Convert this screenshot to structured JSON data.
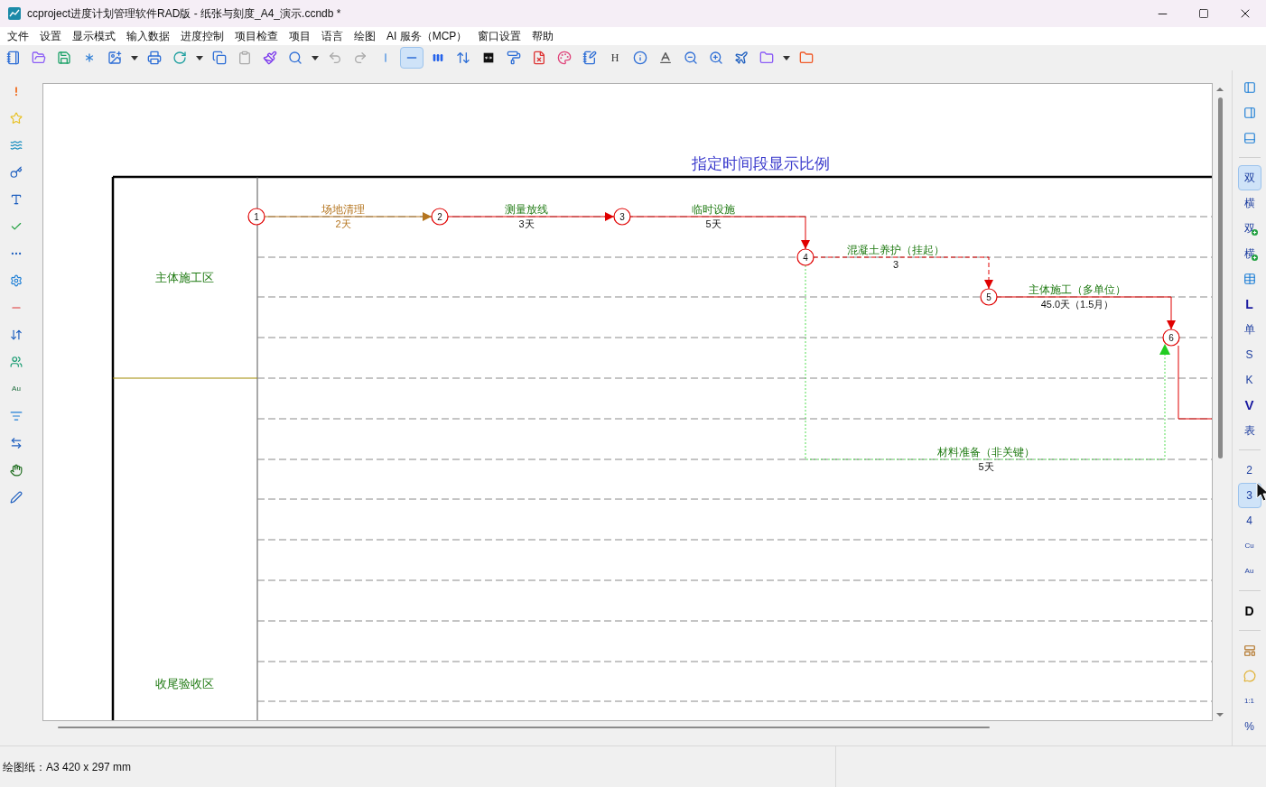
{
  "window": {
    "title": "ccproject进度计划管理软件RAD版 - 纸张与刻度_A4_演示.ccndb *"
  },
  "menu": [
    "文件",
    "设置",
    "显示模式",
    "输入数据",
    "进度控制",
    "项目检查",
    "项目",
    "语言",
    "绘图",
    "AI 服务（MCP）",
    "窗口设置",
    "帮助"
  ],
  "toolbar": [
    {
      "kind": "icon",
      "selected": false
    },
    {
      "kind": "icon",
      "selected": false
    },
    {
      "kind": "icon",
      "selected": false
    },
    {
      "kind": "icon",
      "selected": false
    },
    {
      "kind": "icon",
      "selected": false
    },
    {
      "kind": "caret",
      "selected": false
    },
    {
      "kind": "icon",
      "selected": false
    },
    {
      "kind": "icon",
      "selected": false
    },
    {
      "kind": "caret",
      "selected": false
    },
    {
      "kind": "icon",
      "selected": false
    },
    {
      "kind": "icon",
      "selected": false
    },
    {
      "kind": "icon",
      "selected": false
    },
    {
      "kind": "icon",
      "selected": false
    },
    {
      "kind": "caret",
      "selected": false
    },
    {
      "kind": "icon",
      "selected": false
    },
    {
      "kind": "icon",
      "selected": false
    },
    {
      "kind": "icon",
      "selected": false
    },
    {
      "kind": "icon",
      "selected": true
    },
    {
      "kind": "icon",
      "selected": false
    },
    {
      "kind": "icon",
      "selected": false
    },
    {
      "kind": "icon",
      "selected": false
    },
    {
      "kind": "icon",
      "selected": false
    },
    {
      "kind": "icon",
      "selected": false
    },
    {
      "kind": "icon",
      "selected": false
    },
    {
      "kind": "icon",
      "selected": false
    },
    {
      "kind": "glyph",
      "label": "H",
      "selected": false
    },
    {
      "kind": "icon",
      "selected": false
    },
    {
      "kind": "icon",
      "selected": false
    },
    {
      "kind": "icon",
      "selected": false
    },
    {
      "kind": "icon",
      "selected": false
    },
    {
      "kind": "icon",
      "selected": false
    },
    {
      "kind": "icon",
      "selected": false
    },
    {
      "kind": "caret",
      "selected": false
    },
    {
      "kind": "icon",
      "selected": false
    }
  ],
  "left_toolbar": [
    {
      "kind": "icon"
    },
    {
      "kind": "icon"
    },
    {
      "kind": "icon"
    },
    {
      "kind": "icon"
    },
    {
      "kind": "icon"
    },
    {
      "kind": "icon"
    },
    {
      "kind": "icon"
    },
    {
      "kind": "icon"
    },
    {
      "kind": "icon"
    },
    {
      "kind": "icon"
    },
    {
      "kind": "icon"
    },
    {
      "kind": "text",
      "label": "Au"
    },
    {
      "kind": "icon"
    },
    {
      "kind": "icon"
    },
    {
      "kind": "icon"
    },
    {
      "kind": "icon"
    }
  ],
  "right_toolbar": [
    {
      "kind": "icon",
      "selected": false
    },
    {
      "kind": "icon",
      "selected": false
    },
    {
      "kind": "icon",
      "selected": false
    },
    {
      "kind": "separator"
    },
    {
      "kind": "text",
      "label": "双",
      "selected": true
    },
    {
      "kind": "text",
      "label": "横",
      "selected": false
    },
    {
      "kind": "text-plus",
      "label": "双",
      "selected": false
    },
    {
      "kind": "text-plus",
      "label": "横",
      "selected": false
    },
    {
      "kind": "icon",
      "selected": false
    },
    {
      "kind": "text",
      "label": "L",
      "selected": false
    },
    {
      "kind": "text",
      "label": "单",
      "selected": false
    },
    {
      "kind": "text",
      "label": "S",
      "selected": false
    },
    {
      "kind": "text",
      "label": "K",
      "selected": false
    },
    {
      "kind": "text",
      "label": "V",
      "selected": false
    },
    {
      "kind": "text",
      "label": "表",
      "selected": false
    },
    {
      "kind": "separator"
    },
    {
      "kind": "text",
      "label": "2",
      "selected": false
    },
    {
      "kind": "text",
      "label": "3",
      "selected": true
    },
    {
      "kind": "text",
      "label": "4",
      "selected": false
    },
    {
      "kind": "text",
      "label": "Cu",
      "selected": false
    },
    {
      "kind": "text",
      "label": "Au",
      "selected": false
    },
    {
      "kind": "separator"
    },
    {
      "kind": "text",
      "label": "D",
      "selected": false
    },
    {
      "kind": "separator"
    },
    {
      "kind": "icon",
      "selected": false
    },
    {
      "kind": "icon",
      "selected": false
    },
    {
      "kind": "text",
      "label": "1:1",
      "selected": false
    },
    {
      "kind": "text",
      "label": "%",
      "selected": false
    }
  ],
  "diagram": {
    "title": "指定时间段显示比例",
    "zones": [
      {
        "name": "主体施工区"
      },
      {
        "name": "收尾验收区"
      }
    ],
    "nodes": [
      {
        "label": "1"
      },
      {
        "label": "2"
      },
      {
        "label": "3"
      },
      {
        "label": "4"
      },
      {
        "label": "5"
      },
      {
        "label": "6"
      }
    ],
    "activities": [
      {
        "name": "场地清理",
        "duration": "2天",
        "kind": "normal"
      },
      {
        "name": "测量放线",
        "duration": "3天",
        "kind": "critical"
      },
      {
        "name": "临时设施",
        "duration": "5天",
        "kind": "critical"
      },
      {
        "name": "混凝土养护（挂起）",
        "duration": "3",
        "kind": "suspended"
      },
      {
        "name": "主体施工（多单位）",
        "duration": "45.0天（1.5月）",
        "kind": "critical"
      },
      {
        "name": "材料准备（非关键）",
        "duration": "5天",
        "kind": "noncritical"
      },
      {
        "kind": "critical"
      }
    ]
  },
  "status_bar": {
    "paper": "绘图纸：A3 420 x 297 mm"
  }
}
